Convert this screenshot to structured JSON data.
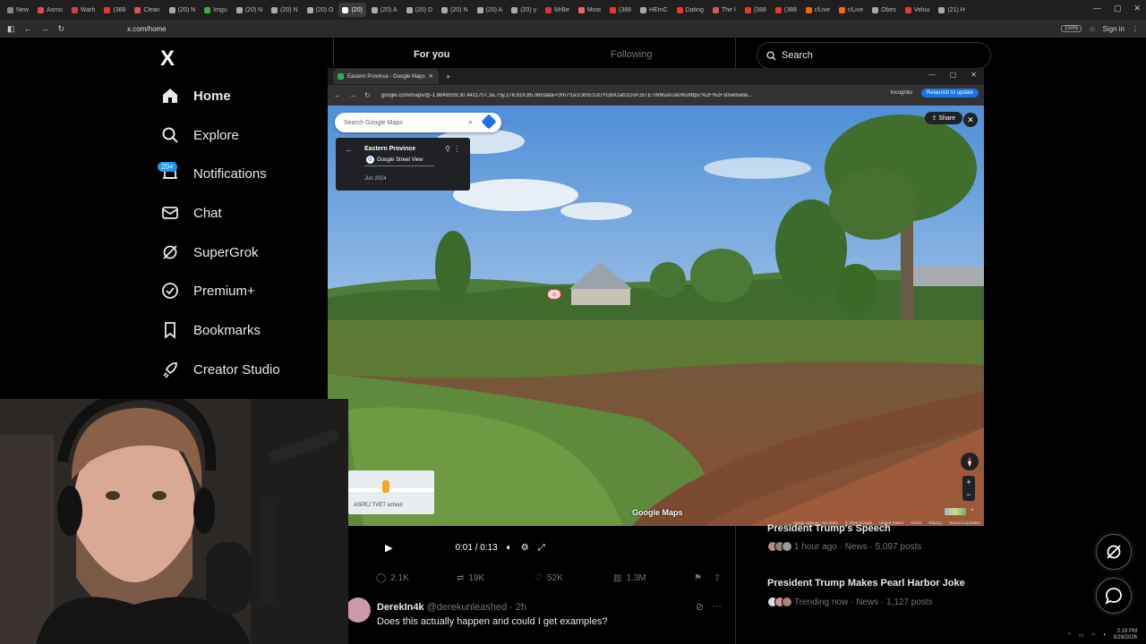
{
  "outer_browser": {
    "tabs": [
      "New",
      "Asmo",
      "Warh",
      "(388",
      "Clean",
      "(20) N",
      "Imgu",
      "(20) N",
      "(20) N",
      "(20) O",
      "(20)",
      "(20) A",
      "(20) D",
      "(20) N",
      "(20) A",
      "(20) y",
      "MrBe",
      "Most",
      "(388",
      "HEmC",
      "Dating",
      "The I",
      "(388",
      "(388",
      "r/Live",
      "r/Live",
      "Obes",
      "Velou",
      "(21) H"
    ],
    "active_tab_index": 10,
    "url": "x.com/home",
    "zoom": "150%",
    "sign_in": "Sign in"
  },
  "x_nav": {
    "logo": "X",
    "items": [
      {
        "label": "Home",
        "icon": "home-icon"
      },
      {
        "label": "Explore",
        "icon": "search-icon"
      },
      {
        "label": "Notifications",
        "icon": "bell-icon"
      },
      {
        "label": "Chat",
        "icon": "mail-icon"
      },
      {
        "label": "SuperGrok",
        "icon": "grok-icon"
      },
      {
        "label": "Premium+",
        "icon": "verified-icon"
      },
      {
        "label": "Bookmarks",
        "icon": "bookmark-icon"
      },
      {
        "label": "Creator Studio",
        "icon": "rocket-icon"
      }
    ],
    "notif_badge": "20+"
  },
  "feed_tabs": {
    "for_you": "For you",
    "following": "Following"
  },
  "search": {
    "placeholder": "Search"
  },
  "maps_window": {
    "tab_title": "Eastern Province - Google Maps",
    "url": "google.com/maps/@-1.8849359,30.4411707,3a,75y,278.91h,85.06t/data=!3m7!1e1!3m5!1sGYO8Xzah2OsPJ5TE7WMuAI2e0!6shttps:%2F%2Fstreetview...",
    "incognito": "Incognito",
    "relaunch": "Relaunch to update",
    "search_placeholder": "Search Google Maps",
    "card_title": "Eastern Province",
    "card_source": "Google Street View",
    "card_date": "Jun 2024",
    "share": "Share",
    "minimap_label": "ASPEJ TVET school",
    "logo": "Google Maps",
    "footer": [
      "Image capture: Jun 2024",
      "© 2026 Google",
      "United States",
      "Terms",
      "Privacy",
      "Report a problem"
    ]
  },
  "video": {
    "time": "0:01 / 0:13"
  },
  "tweet_actions": {
    "replies": "2.1K",
    "reposts": "19K",
    "likes": "52K",
    "views": "1.3M"
  },
  "tweet2": {
    "name": "DerekIn4k",
    "handle": "@derekunleashed · 2h",
    "text": "Does this actually happen and could I get examples?"
  },
  "trends": [
    {
      "title": "President Trump's Speech",
      "meta": "1 hour ago · News · 5,097 posts"
    },
    {
      "title": "President Trump Makes Pearl Harbor Joke",
      "meta": "Trending now · News · 1,127 posts"
    }
  ],
  "taskbar": {
    "time": "2:19 PM",
    "date": "3/29/2026"
  },
  "colors": {
    "accent": "#1d9bf0",
    "bg": "#000000",
    "muted": "#71767b"
  }
}
